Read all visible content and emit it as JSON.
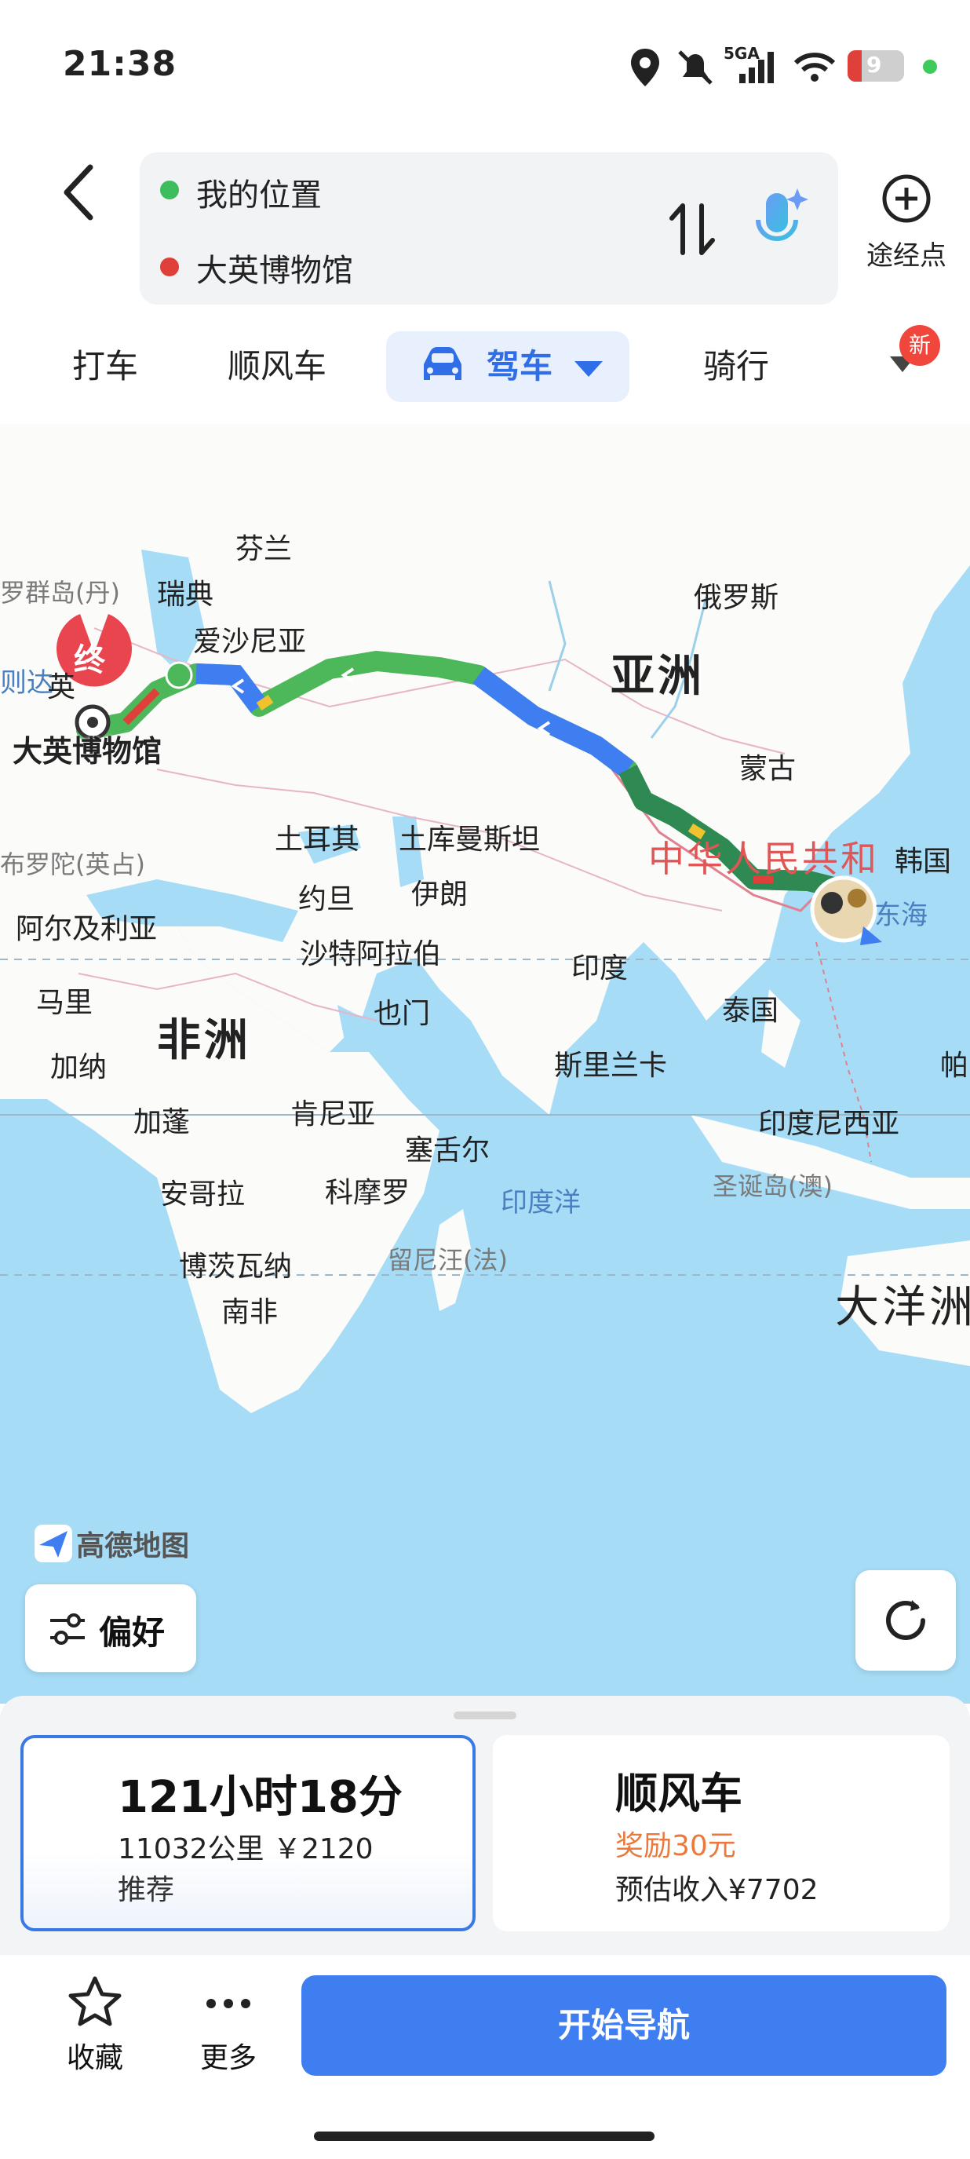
{
  "status_bar": {
    "time": "21:38",
    "network": "5GA",
    "battery": "9",
    "icons": [
      "location-icon",
      "mute-icon",
      "signal-icon",
      "wifi-icon",
      "battery-icon"
    ]
  },
  "header": {
    "origin": "我的位置",
    "destination": "大英博物馆",
    "waypoint_label": "途经点",
    "origin_color": "#3dbd5c",
    "destination_color": "#e0403a"
  },
  "tabs": {
    "taxi": "打车",
    "carpool": "顺风车",
    "drive": "驾车",
    "ride": "骑行",
    "new_badge": "新"
  },
  "map": {
    "labels": {
      "finland": "芬兰",
      "sweden": "瑞典",
      "faroe": "罗群岛(丹)",
      "estonia": "爱沙尼亚",
      "russia": "俄罗斯",
      "asia": "亚洲",
      "mongolia": "蒙古",
      "turkey": "土耳其",
      "turkmenistan": "土库曼斯坦",
      "china": "中华人民共和",
      "korea": "韩国",
      "east_sea": "东海",
      "morocco": "布罗陀(英占)",
      "algeria": "阿尔及利亚",
      "jordan": "约旦",
      "iran": "伊朗",
      "saudi": "沙特阿拉伯",
      "india": "印度",
      "mali": "马里",
      "yemen": "也门",
      "thailand": "泰国",
      "africa": "非洲",
      "ghana": "加纳",
      "srilanka": "斯里兰卡",
      "palau": "帕",
      "gabon": "加蓬",
      "kenya": "肯尼亚",
      "indonesia": "印度尼西亚",
      "seychelles": "塞舌尔",
      "angola": "安哥拉",
      "comoros": "科摩罗",
      "indian_ocean": "印度洋",
      "christmas": "圣诞岛(澳)",
      "botswana": "博茨瓦纳",
      "reunion": "留尼汪(法)",
      "southafrica": "南非",
      "oceania": "大洋洲",
      "uk": "英",
      "ireland": "则达",
      "destination_marker": "大英博物馆",
      "end_pin": "终"
    },
    "logo": "高德地图",
    "route_colors": {
      "green": "#4cb85a",
      "blue": "#3f7ef0",
      "dark": "#2e8a52",
      "red": "#e0403a",
      "yellow": "#f2c12e"
    }
  },
  "preference_button": "偏好",
  "route_card": {
    "duration": "121小时18分",
    "distance_cost": "11032公里 ￥2120",
    "tag": "推荐"
  },
  "carpool_card": {
    "title": "顺风车",
    "reward": "奖励30元",
    "income": "预估收入¥7702"
  },
  "bottom_bar": {
    "favorite": "收藏",
    "more": "更多",
    "start_nav": "开始导航"
  }
}
